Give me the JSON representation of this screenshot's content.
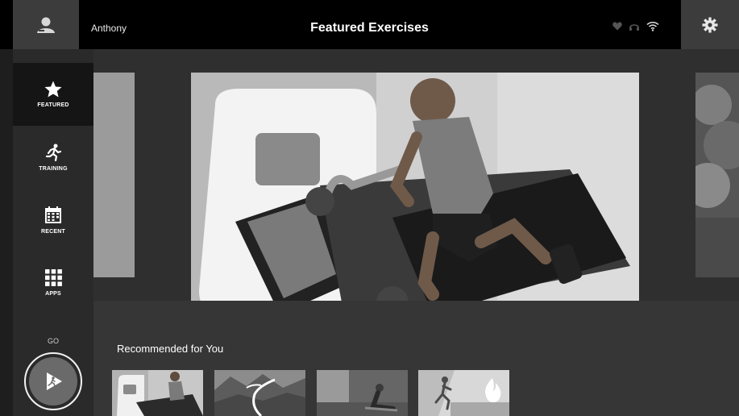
{
  "header": {
    "user_name": "Anthony",
    "title": "Featured Exercises",
    "status_icons": [
      "heart-icon",
      "headphones-icon",
      "wifi-icon"
    ],
    "profile_icon": "user-profile-icon",
    "settings_icon": "gear-icon"
  },
  "sidebar": {
    "items": [
      {
        "label": "FEATURED",
        "icon": "star-icon",
        "active": true
      },
      {
        "label": "TRAINING",
        "icon": "runner-icon",
        "active": false
      },
      {
        "label": "RECENT",
        "icon": "calendar-icon",
        "active": false
      },
      {
        "label": "APPS",
        "icon": "apps-grid-icon",
        "active": false
      }
    ],
    "go_label": "GO",
    "go_icon": "play-runner-icon"
  },
  "carousel": {
    "slides": [
      "treadmill-runner-image",
      "side-slide-left",
      "side-slide-right-forest"
    ]
  },
  "recommended": {
    "title": "Recommended for You",
    "items": [
      {
        "image": "treadmill-runner-thumb"
      },
      {
        "image": "mountain-trail-thumb"
      },
      {
        "image": "seated-stretch-thumb"
      },
      {
        "image": "running-flame-thumb"
      }
    ]
  },
  "colors": {
    "topbar": "#000000",
    "background": "#2e2e2e",
    "active_nav": "#151515"
  }
}
